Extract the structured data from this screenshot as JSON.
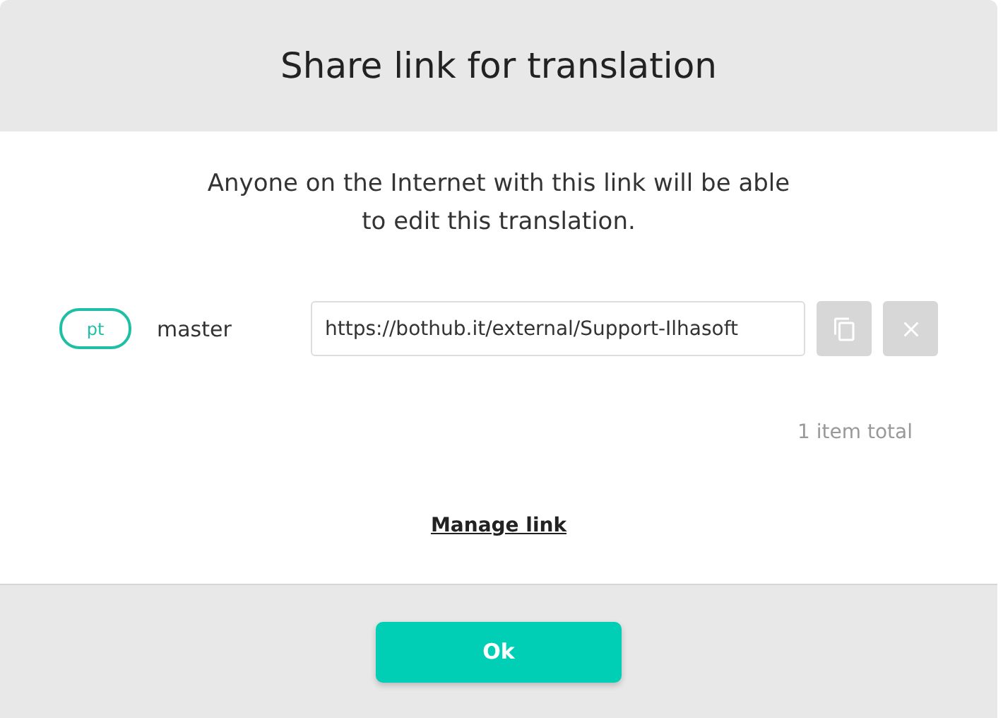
{
  "dialog": {
    "title": "Share link for translation",
    "message": "Anyone on the Internet with this link will be able to edit this translation.",
    "links": [
      {
        "language": "pt",
        "branch": "master",
        "url": "https://bothub.it/external/Support-Ilhasoft"
      }
    ],
    "total": "1 item total",
    "manage_link": "Manage link",
    "buttons": [
      "Ok"
    ]
  }
}
